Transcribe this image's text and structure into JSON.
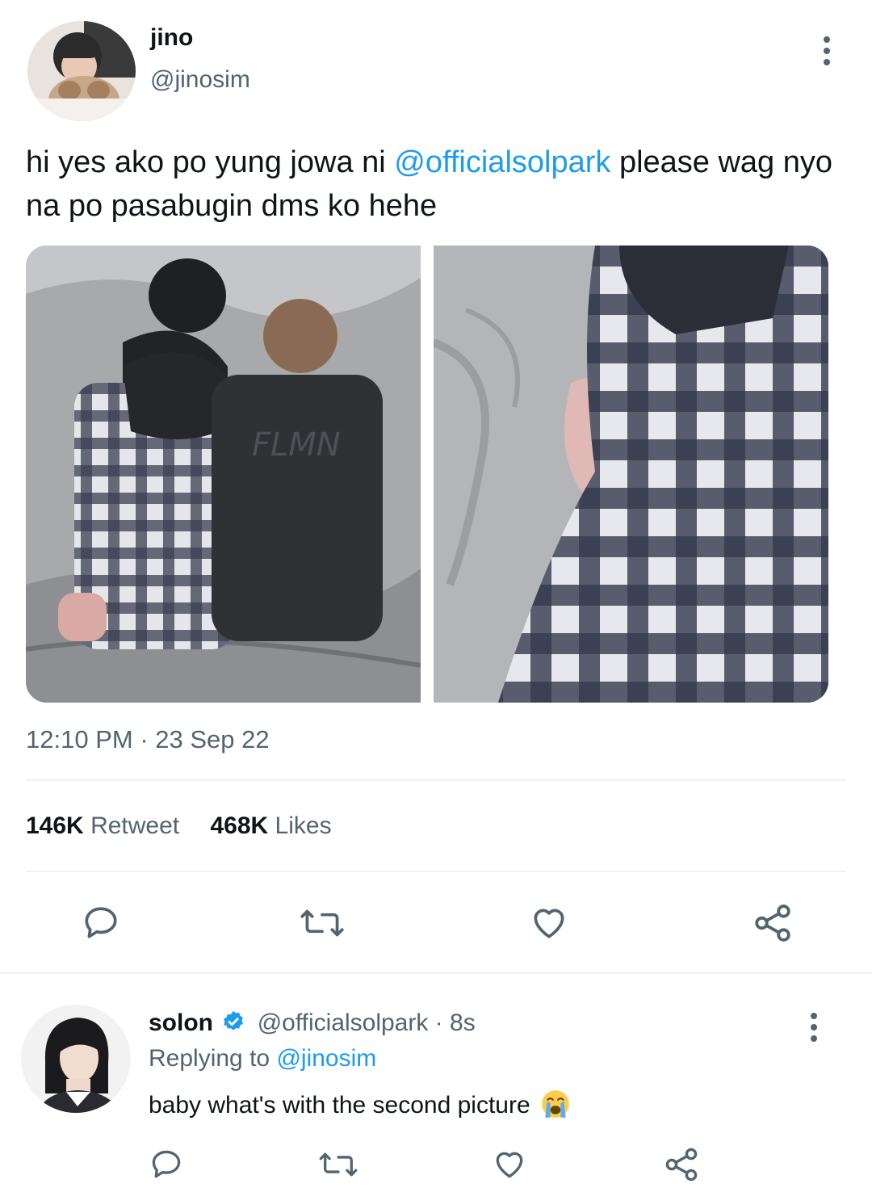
{
  "tweet": {
    "author_name": "jino",
    "author_handle": "@jinosim",
    "text_before": "hi yes ako po yung jowa ni ",
    "mention": "@officialsolpark",
    "text_after": " please wag nyo na po pasabugin dms ko hehe",
    "time": "12:10 PM",
    "separator": " · ",
    "date": "23 Sep 22",
    "stats": {
      "retweets_count": "146K",
      "retweets_label": "Retweet",
      "likes_count": "468K",
      "likes_label": "Likes"
    },
    "photos": [
      "photo-1",
      "photo-2"
    ]
  },
  "reply": {
    "author_name": "solon",
    "author_handle": "@officialsolpark",
    "time_sep": " · ",
    "time": "8s",
    "replying_prefix": "Replying to ",
    "replying_handle": "@jinosim",
    "text": "baby what's with the second picture",
    "emoji": "😭"
  },
  "colors": {
    "accent": "#1d9bf0",
    "muted": "#536471",
    "verified": "#1d9bf0",
    "divider": "#eff3f4"
  },
  "icons": [
    "more-icon",
    "reply-icon",
    "retweet-icon",
    "like-icon",
    "share-icon",
    "verified-badge-icon",
    "crying-emoji-icon"
  ]
}
